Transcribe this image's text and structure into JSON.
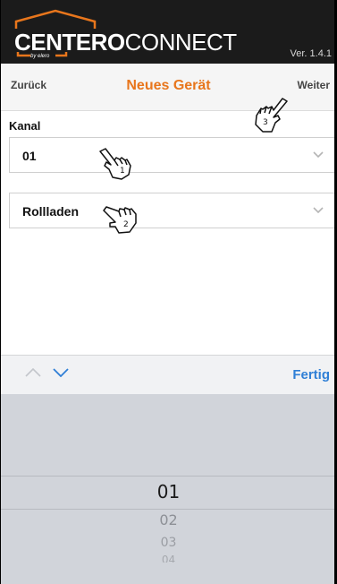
{
  "header": {
    "logo_bold": "CENTERO",
    "logo_light": "CONNECT",
    "logo_sub": "by elero",
    "version": "Ver. 1.4.1"
  },
  "nav": {
    "back_label": "Zurück",
    "title": "Neues Gerät",
    "next_label": "Weiter"
  },
  "form": {
    "channel_label": "Kanal",
    "channel_value": "01",
    "device_type_value": "Rollladen"
  },
  "hand_markers": [
    "1",
    "2",
    "3"
  ],
  "keyboard_toolbar": {
    "done_label": "Fertig"
  },
  "picker": {
    "options": [
      "01",
      "02",
      "03",
      "04"
    ],
    "selected": "01"
  },
  "colors": {
    "brand_orange": "#e8761c",
    "header_bg": "#1b1b1b",
    "ios_blue": "#2f7fd6"
  },
  "icons": [
    "house-roof-logo-icon",
    "chevron-down-icon",
    "chevron-up-icon",
    "pointing-hand-icon"
  ]
}
